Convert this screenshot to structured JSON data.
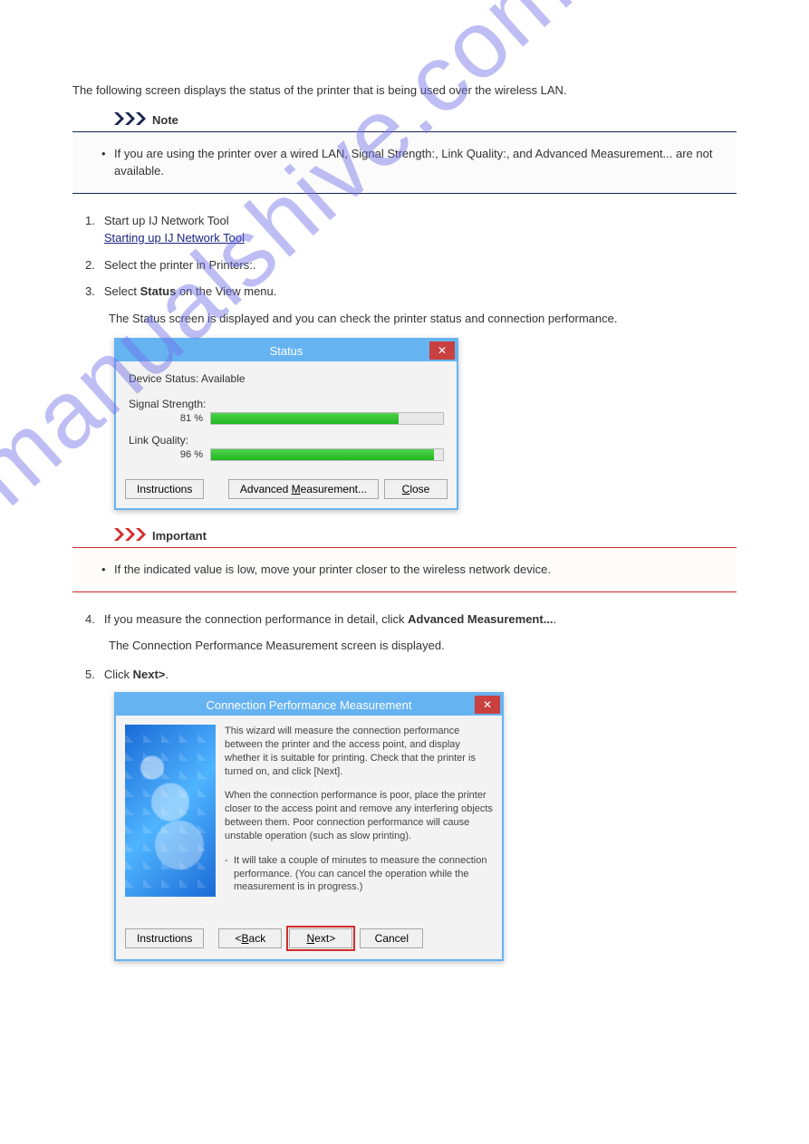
{
  "watermark": "manualshive.com",
  "intro": "The following screen displays the status of the printer that is being used over the wireless LAN.",
  "note1": {
    "label": "Note",
    "text": "If you are using the printer over a wired LAN, Signal Strength:, Link Quality:, and Advanced Measurement... are not available."
  },
  "step1": {
    "num": "1.",
    "lead": "Start up IJ Network Tool",
    "link": "Starting up IJ Network Tool"
  },
  "step2": {
    "num": "2.",
    "text": "Select the printer in Printers:."
  },
  "step3": {
    "num": "3.",
    "text_pre": "Select ",
    "bold": "Status",
    "text_post": " on the View menu."
  },
  "sub_status": "The Status screen is displayed and you can check the printer status and connection performance.",
  "status_dialog": {
    "title": "Status",
    "device_status_label": "Device Status:",
    "device_status_value": "Available",
    "signal_label": "Signal Strength:",
    "signal_pct": "81 %",
    "signal_fill": 81,
    "link_label": "Link Quality:",
    "link_pct": "96 %",
    "link_fill": 96,
    "btn_instructions": "Instructions",
    "btn_advanced": "Advanced Measurement...",
    "btn_advanced_u": "M",
    "btn_close": "Close",
    "btn_close_u": "C"
  },
  "important": {
    "label": "Important",
    "text": "If the indicated value is low, move your printer closer to the wireless network device."
  },
  "step4": {
    "num": "4.",
    "text_pre": "If you measure the connection performance in detail, click ",
    "bold": "Advanced Measurement...",
    "text_post": "."
  },
  "sub_wizard": "The Connection Performance Measurement screen is displayed.",
  "step5": {
    "num": "5.",
    "text_pre": "Click ",
    "bold": "Next>",
    "text_post": "."
  },
  "wizard_dialog": {
    "title": "Connection Performance Measurement",
    "p1": "This wizard will measure the connection performance between the printer and the access point, and display whether it is suitable for printing. Check that the printer is turned on, and click [Next].",
    "p2": "When the connection performance is poor, place the printer closer to the access point and remove any interfering objects between them. Poor connection performance will cause unstable operation (such as slow printing).",
    "p3": "It will take a couple of minutes to measure the connection performance. (You can cancel the operation while the measurement is in progress.)",
    "btn_instructions": "Instructions",
    "btn_back": "<Back",
    "btn_back_u": "B",
    "btn_next": "Next>",
    "btn_next_u": "N",
    "btn_cancel": "Cancel"
  }
}
